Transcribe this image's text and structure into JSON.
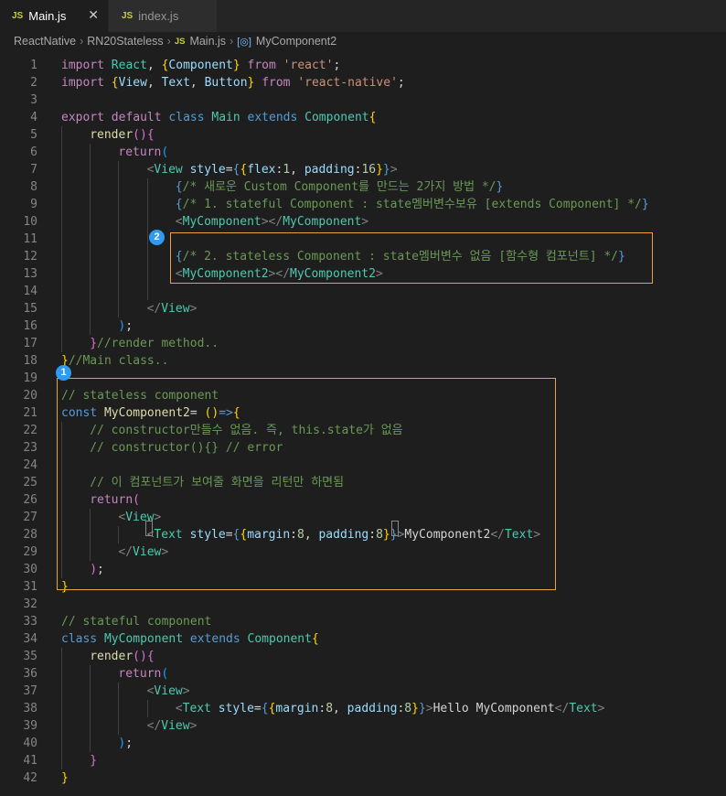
{
  "tabs": [
    {
      "icon": "JS",
      "label": "Main.js",
      "close": "✕"
    },
    {
      "icon": "JS",
      "label": "index.js"
    }
  ],
  "breadcrumb": {
    "project": "ReactNative",
    "folder": "RN20Stateless",
    "file_icon": "JS",
    "file": "Main.js",
    "symbol_icon": "[◎]",
    "symbol": "MyComponent2",
    "separator": "›"
  },
  "badges": {
    "one": "1",
    "two": "2"
  },
  "colors": {
    "highlight_border": "#e8a33d",
    "badge_bg": "#2e9bf0",
    "background": "#1e1e1e"
  },
  "code": {
    "l1": [
      "import",
      " ",
      "React",
      ", ",
      "{",
      "Component",
      "}",
      " ",
      "from",
      " ",
      "'react'",
      ";"
    ],
    "l2": [
      "import",
      " ",
      "{",
      "View",
      ", ",
      "Text",
      ", ",
      "Button",
      "}",
      " ",
      "from",
      " ",
      "'react-native'",
      ";"
    ],
    "l4": [
      "export",
      " ",
      "default",
      " ",
      "class",
      " ",
      "Main",
      " ",
      "extends",
      " ",
      "Component",
      "{"
    ],
    "l5": [
      "render",
      "(",
      ")",
      "{"
    ],
    "l6": [
      "return",
      "("
    ],
    "l7": [
      "<",
      "View",
      " ",
      "style",
      "=",
      "{",
      "{",
      "flex",
      ":",
      "1",
      ", ",
      "padding",
      ":",
      "16",
      "}",
      "}",
      ">"
    ],
    "l8": [
      "{",
      "/* 새로운 Custom Component를 만드는 2가지 방법 */",
      "}"
    ],
    "l9": [
      "{",
      "/* 1. stateful Component : state멤버변수보유 [extends Component] */",
      "}"
    ],
    "l10": [
      "<",
      "MyComponent",
      "></",
      "MyComponent",
      ">"
    ],
    "l12": [
      "{",
      "/* 2. stateless Component : state멤버변수 없음 [함수형 컴포넌트] */",
      "}"
    ],
    "l13": [
      "<",
      "MyComponent2",
      "></",
      "MyComponent2",
      ">"
    ],
    "l15": [
      "</",
      "View",
      ">"
    ],
    "l16": [
      ")",
      ";"
    ],
    "l17": [
      "}",
      "//render method.."
    ],
    "l18": [
      "}",
      "//Main class.."
    ],
    "l20": [
      "// stateless component"
    ],
    "l21": [
      "const",
      " ",
      "MyComponent2",
      "= ",
      "(",
      ")",
      "=>",
      "{"
    ],
    "l22": [
      "// constructor만들수 없음. 즉, this.state가 없음"
    ],
    "l23": [
      "// constructor(){} // error"
    ],
    "l25": [
      "// 이 컴포넌트가 보여줄 화면을 리턴만 하면됨"
    ],
    "l26": [
      "return",
      "("
    ],
    "l27": [
      "<",
      "View",
      ">"
    ],
    "l28": [
      "<",
      "Text",
      " ",
      "style",
      "=",
      "{",
      "{",
      "margin",
      ":",
      "8",
      ", ",
      "padding",
      ":",
      "8",
      "}",
      "}",
      ">",
      "MyComponent2",
      "</",
      "Text",
      ">"
    ],
    "l29": [
      "</",
      "View",
      ">"
    ],
    "l30": [
      ")",
      ";"
    ],
    "l31": [
      "}"
    ],
    "l33": [
      "// stateful component"
    ],
    "l34": [
      "class",
      " ",
      "MyComponent",
      " ",
      "extends",
      " ",
      "Component",
      "{"
    ],
    "l35": [
      "render",
      "(",
      ")",
      "{"
    ],
    "l36": [
      "return",
      "("
    ],
    "l37": [
      "<",
      "View",
      ">"
    ],
    "l38": [
      "<",
      "Text",
      " ",
      "style",
      "=",
      "{",
      "{",
      "margin",
      ":",
      "8",
      ", ",
      "padding",
      ":",
      "8",
      "}",
      "}",
      ">",
      "Hello MyComponent",
      "</",
      "Text",
      ">"
    ],
    "l39": [
      "</",
      "View",
      ">"
    ],
    "l40": [
      ")",
      ";"
    ],
    "l41": [
      "}"
    ],
    "l42": [
      "}"
    ]
  }
}
